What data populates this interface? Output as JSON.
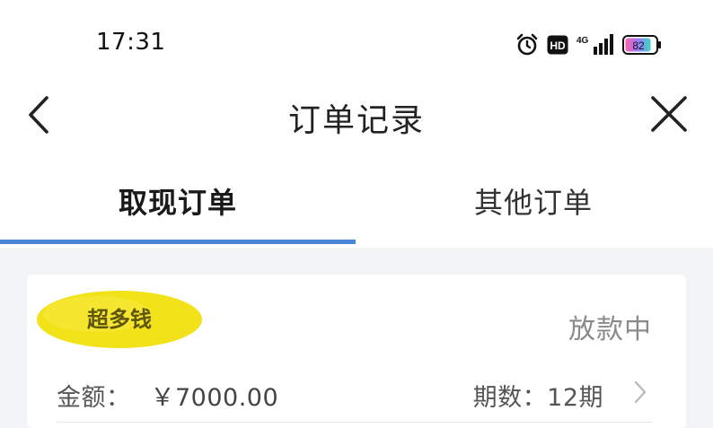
{
  "status_bar": {
    "time": "17:31",
    "icons": [
      "alarm-icon",
      "hd-icon",
      "signal-4g-icon",
      "battery-icon"
    ],
    "network_label": "4G",
    "hd_label": "HD",
    "battery_level": "82"
  },
  "nav": {
    "title": "订单记录",
    "back_icon": "chevron-left-icon",
    "close_icon": "close-icon"
  },
  "tabs": [
    {
      "label": "取现订单",
      "active": true
    },
    {
      "label": "其他订单",
      "active": false
    }
  ],
  "colors": {
    "accent": "#4a86d8",
    "list_background": "#f3f4f6",
    "status_text": "#8a8a8a",
    "highlight": "#f2e21a"
  },
  "order": {
    "name_text": "超多钱",
    "status": "放款中",
    "amount_label": "金额：",
    "amount_value": "￥7000.00",
    "periods": "期数：12期"
  }
}
